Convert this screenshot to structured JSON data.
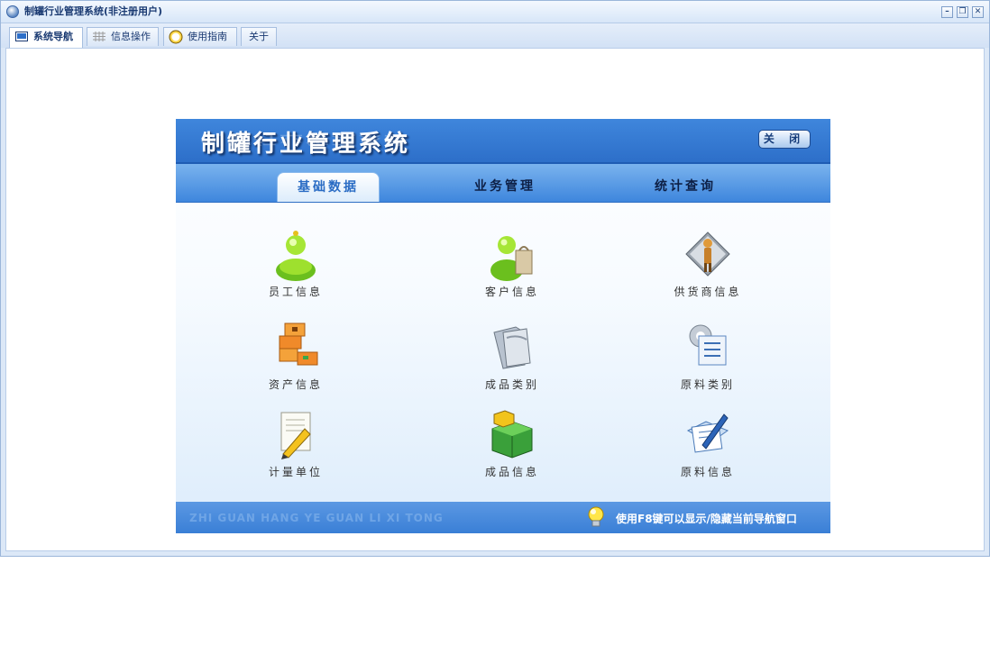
{
  "window": {
    "title": "制罐行业管理系统(非注册用户)",
    "controls": {
      "minimize": "–",
      "restore": "❐",
      "close": "✕"
    }
  },
  "tabs": [
    {
      "label": "系统导航",
      "icon": "monitor-icon",
      "active": true
    },
    {
      "label": "信息操作",
      "icon": "grid-icon",
      "active": false
    },
    {
      "label": "使用指南",
      "icon": "clock-icon",
      "active": false
    },
    {
      "label": "关于",
      "icon": "",
      "active": false
    }
  ],
  "panel": {
    "title": "制罐行业管理系统",
    "close_label": "关 闭",
    "nav": [
      "基础数据",
      "业务管理",
      "统计查询"
    ],
    "active_nav": "基础数据",
    "items": [
      {
        "label": "员工信息",
        "icon": "user-icon"
      },
      {
        "label": "客户信息",
        "icon": "customer-icon"
      },
      {
        "label": "供货商信息",
        "icon": "supplier-icon"
      },
      {
        "label": "资产信息",
        "icon": "boxes-icon"
      },
      {
        "label": "成品类别",
        "icon": "folder-icon"
      },
      {
        "label": "原料类别",
        "icon": "settings-doc-icon"
      },
      {
        "label": "计量单位",
        "icon": "edit-doc-icon"
      },
      {
        "label": "成品信息",
        "icon": "cubes-icon"
      },
      {
        "label": "原料信息",
        "icon": "pen-doc-icon"
      }
    ],
    "footer_watermark": "ZHI GUAN HANG YE GUAN LI XI TONG",
    "footer_hint": "使用F8键可以显示/隐藏当前导航窗口"
  },
  "colors": {
    "header_blue": "#2d6fc9",
    "nav_blue": "#3e86dd",
    "footer_blue": "#3a7fd6"
  }
}
